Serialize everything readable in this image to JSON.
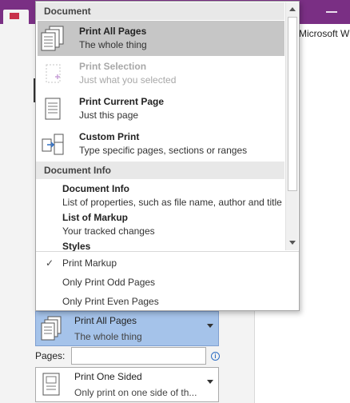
{
  "background": {
    "right_text": "Microsoft W"
  },
  "popup": {
    "sections": [
      {
        "heading": "Document",
        "items": [
          {
            "title": "Print All Pages",
            "subtitle": "The whole thing",
            "icon": "all-pages-icon",
            "selected": true,
            "disabled": false
          },
          {
            "title": "Print Selection",
            "subtitle": "Just what you selected",
            "icon": "selection-icon",
            "selected": false,
            "disabled": true
          },
          {
            "title": "Print Current Page",
            "subtitle": "Just this page",
            "icon": "current-page-icon",
            "selected": false,
            "disabled": false
          },
          {
            "title": "Custom Print",
            "subtitle": "Type specific pages, sections or ranges",
            "icon": "custom-print-icon",
            "selected": false,
            "disabled": false
          }
        ]
      },
      {
        "heading": "Document Info",
        "items": [
          {
            "title": "Document Info",
            "subtitle": "List of properties, such as file name, author and title"
          },
          {
            "title": "List of Markup",
            "subtitle": "Your tracked changes"
          },
          {
            "title": "Styles",
            "subtitle": ""
          }
        ]
      }
    ],
    "options": [
      {
        "label": "Print Markup",
        "checked": true
      },
      {
        "label": "Only Print Odd Pages",
        "checked": false
      },
      {
        "label": "Only Print Even Pages",
        "checked": false
      }
    ],
    "check_glyph": "✓"
  },
  "settings": {
    "print_range": {
      "title": "Print All Pages",
      "subtitle": "The whole thing"
    },
    "pages_label": "Pages:",
    "pages_value": "",
    "sides": {
      "title": "Print One Sided",
      "subtitle": "Only print on one side of th..."
    }
  },
  "colors": {
    "title_bar": "#7a2f84",
    "selected_item": "#c6c6c6",
    "active_dropdown": "#a5c3ea"
  }
}
